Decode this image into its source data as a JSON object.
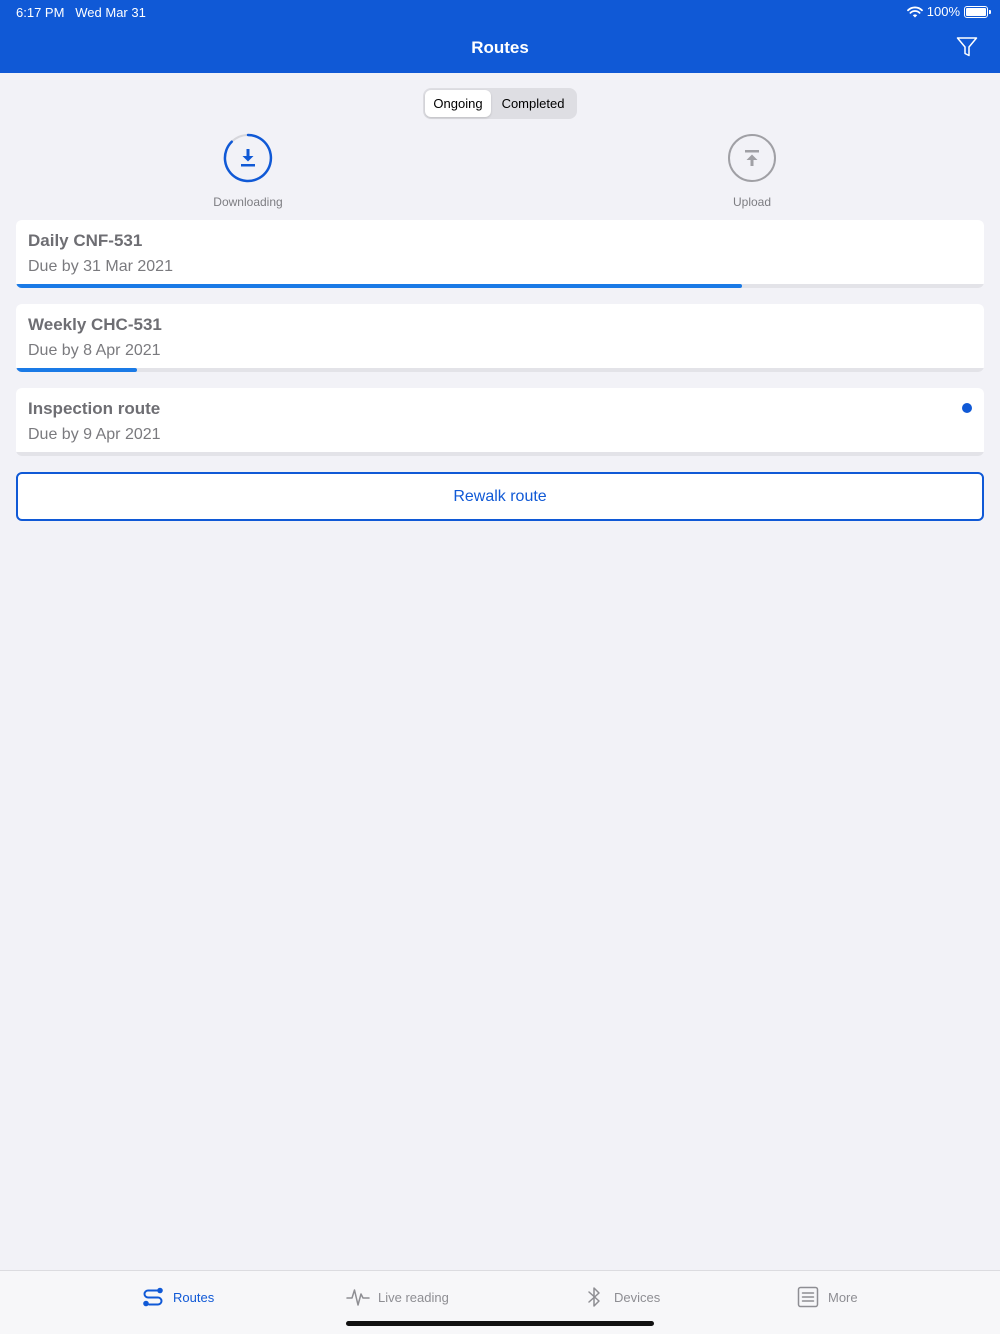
{
  "status": {
    "time": "6:17 PM",
    "date": "Wed Mar 31",
    "battery": "100%"
  },
  "header": {
    "title": "Routes"
  },
  "segments": {
    "ongoing": "Ongoing",
    "completed": "Completed"
  },
  "actions": {
    "download_label": "Downloading",
    "upload_label": "Upload"
  },
  "routes": [
    {
      "title": "Daily CNF-531",
      "due": "Due by 31 Mar 2021",
      "progress": 0.75
    },
    {
      "title": "Weekly CHC-531",
      "due": "Due by 8 Apr 2021",
      "progress": 0.125
    },
    {
      "title": "Inspection route",
      "due": "Due by 9 Apr 2021",
      "progress": 0
    }
  ],
  "rewalk_label": "Rewalk route",
  "tabs": {
    "routes": "Routes",
    "live": "Live reading",
    "devices": "Devices",
    "more": "More"
  },
  "colors": {
    "brand": "#1059d6",
    "progress": "#1a7ae6",
    "background": "#f2f2f7"
  }
}
